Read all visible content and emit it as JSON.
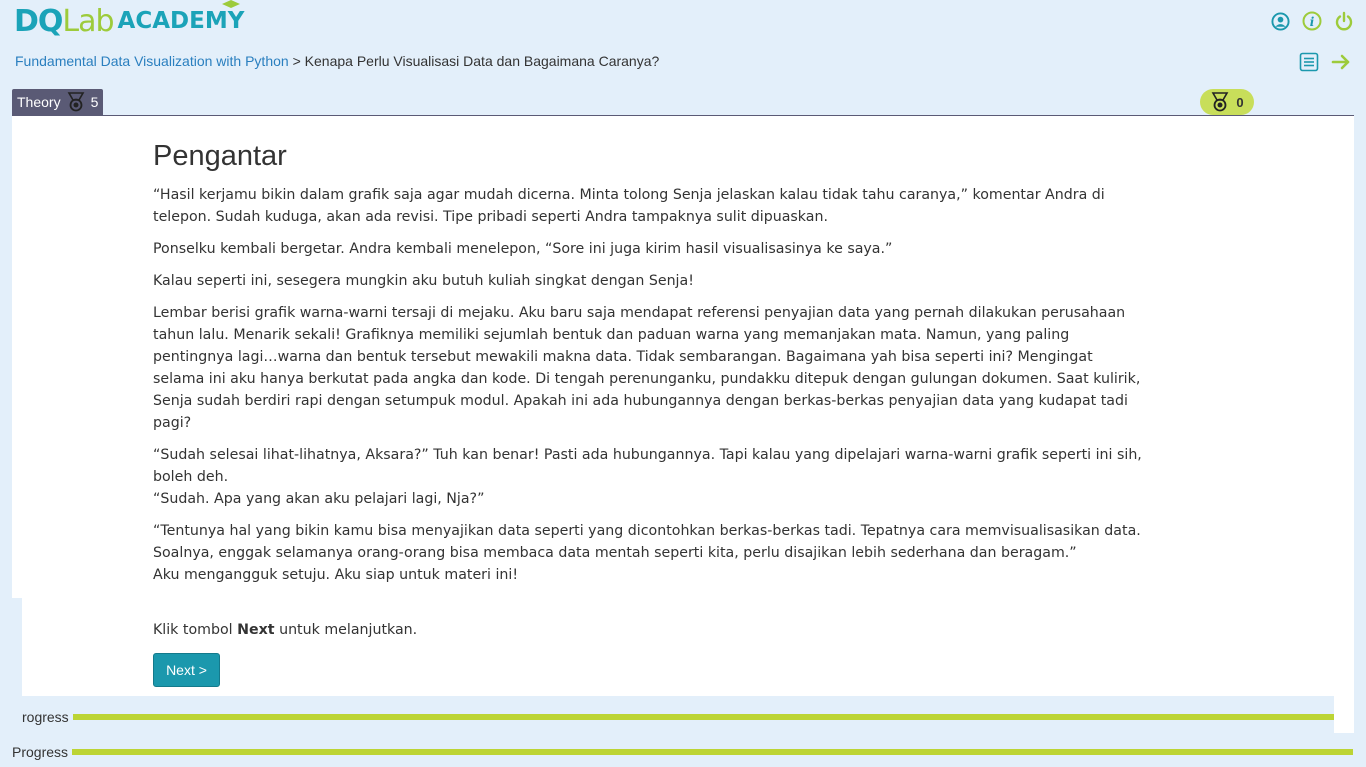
{
  "header": {
    "logo_part1": "DQ",
    "logo_part2": "Lab",
    "logo_part3": "ACADEMY",
    "icons": [
      "user-icon",
      "info-icon",
      "power-icon"
    ]
  },
  "breadcrumb": {
    "course": "Fundamental Data Visualization with Python",
    "separator": ">",
    "current": "Kenapa Perlu Visualisasi Data dan Bagaimana Caranya?"
  },
  "nav": {
    "icons": [
      "list-icon",
      "arrow-right-icon"
    ]
  },
  "tabs": {
    "theory_label": "Theory",
    "theory_count": "5",
    "score": "0"
  },
  "article": {
    "title": "Pengantar",
    "paragraphs": [
      "“Hasil kerjamu bikin dalam grafik saja agar mudah dicerna. Minta tolong Senja jelaskan kalau tidak tahu caranya,” komentar Andra di telepon. Sudah kuduga, akan ada revisi. Tipe pribadi seperti Andra tampaknya sulit dipuaskan.",
      "Ponselku kembali bergetar. Andra kembali menelepon, “Sore ini juga kirim hasil visualisasinya ke saya.”",
      "Kalau seperti ini, sesegera mungkin aku butuh kuliah singkat dengan Senja!",
      "Lembar berisi grafik warna-warni tersaji di mejaku. Aku baru saja mendapat referensi penyajian data yang pernah dilakukan perusahaan tahun lalu. Menarik sekali! Grafiknya memiliki sejumlah bentuk dan paduan warna yang memanjakan mata. Namun, yang paling pentingnya lagi…warna dan bentuk tersebut mewakili makna data. Tidak sembarangan. Bagaimana yah bisa seperti ini? Mengingat selama ini aku hanya berkutat pada angka dan kode. Di tengah perenunganku, pundakku ditepuk dengan gulungan dokumen. Saat kulirik, Senja sudah berdiri rapi dengan setumpuk modul. Apakah ini ada hubungannya dengan berkas-berkas penyajian data yang kudapat tadi pagi?"
    ],
    "p5_line1": "“Sudah selesai lihat-lihatnya, Aksara?” Tuh kan benar! Pasti ada hubungannya. Tapi kalau yang dipelajari warna-warni grafik seperti ini sih, boleh deh.",
    "p5_line2": "“Sudah. Apa yang akan aku pelajari lagi, Nja?”",
    "p6_line1": "“Tentunya hal yang bikin kamu bisa menyajikan data seperti yang dicontohkan berkas-berkas tadi. Tepatnya cara memvisualisasikan data. Soalnya, enggak selamanya orang-orang bisa membaca data mentah seperti kita, perlu disajikan lebih sederhana dan beragam.”",
    "p6_line2": "Aku mengangguk setuju. Aku siap untuk materi ini!"
  },
  "instruction": {
    "prefix": "Klik tombol",
    "bold": "Next",
    "suffix": "untuk melanjutkan."
  },
  "next_button": "Next >",
  "progress": {
    "label_1": "rogress",
    "label_2": "Progress",
    "value_1": 1.0,
    "value_2": 1.0
  },
  "colors": {
    "brand_teal": "#1ba3b8",
    "brand_green": "#9dcb3b",
    "progress_green": "#bcd434",
    "tab_dark": "#5a5a75",
    "badge_green": "#c8de5a"
  }
}
